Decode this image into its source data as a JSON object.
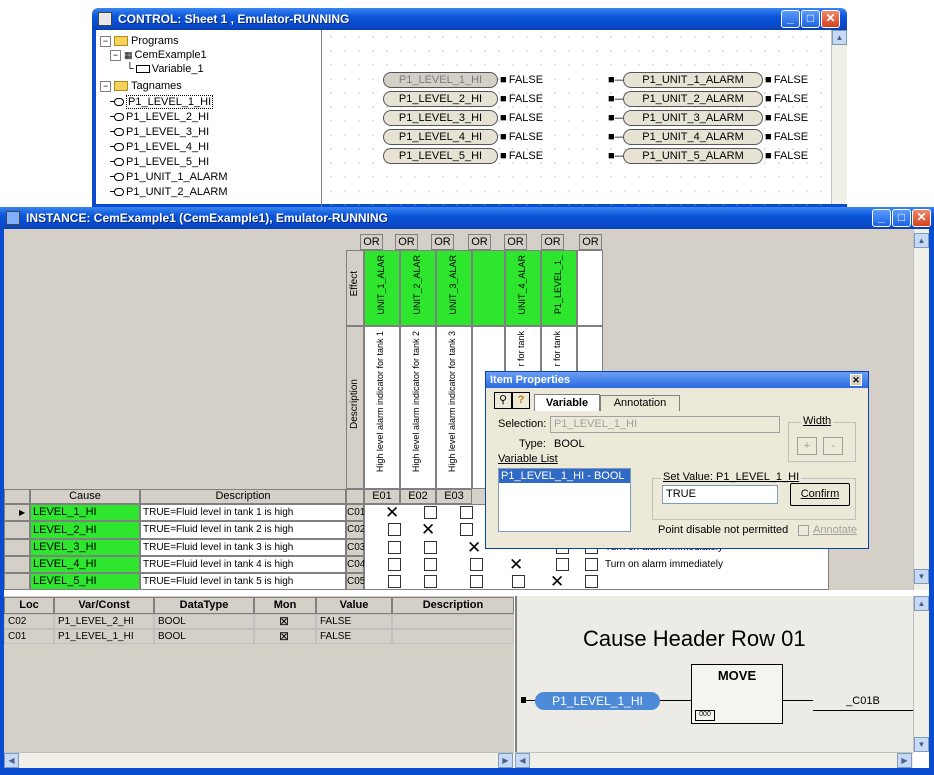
{
  "control_window": {
    "title": "CONTROL: Sheet 1 , Emulator-RUNNING",
    "tree": {
      "programs": "Programs",
      "program_item": "CemExample1",
      "variable_item": "Variable_1",
      "tagnames": "Tagnames",
      "tags": [
        "P1_LEVEL_1_HI",
        "P1_LEVEL_2_HI",
        "P1_LEVEL_3_HI",
        "P1_LEVEL_4_HI",
        "P1_LEVEL_5_HI",
        "P1_UNIT_1_ALARM",
        "P1_UNIT_2_ALARM"
      ]
    },
    "sheet": {
      "inputs": [
        "P1_LEVEL_1_HI",
        "P1_LEVEL_2_HI",
        "P1_LEVEL_3_HI",
        "P1_LEVEL_4_HI",
        "P1_LEVEL_5_HI"
      ],
      "input_values": [
        "FALSE",
        "FALSE",
        "FALSE",
        "FALSE",
        "FALSE"
      ],
      "outputs": [
        "P1_UNIT_1_ALARM",
        "P1_UNIT_2_ALARM",
        "P1_UNIT_3_ALARM",
        "P1_UNIT_4_ALARM",
        "P1_UNIT_5_ALARM"
      ],
      "output_values": [
        "FALSE",
        "FALSE",
        "FALSE",
        "FALSE",
        "FALSE"
      ]
    }
  },
  "instance_window": {
    "title": "INSTANCE: CemExample1  (CemExample1), Emulator-RUNNING",
    "effect_label": "Effect",
    "description_label": "Description",
    "or_labels": [
      "OR",
      "OR",
      "OR",
      "OR",
      "OR",
      "OR"
    ],
    "effects": [
      "UNIT_1_ALAR",
      "UNIT_2_ALAR",
      "UNIT_3_ALAR",
      "UNIT_4_ALAR",
      "P1_LEVEL_1_"
    ],
    "effect_descriptions": [
      "High level alarm indicator for tank 1",
      "High level alarm indicator for tank 2",
      "High level alarm indicator for tank 3",
      "r for tank",
      "r for tank"
    ],
    "effect_ids": [
      "E01",
      "E02",
      "E03"
    ],
    "cause_header": "Cause",
    "description_header": "Description",
    "causes": [
      {
        "name": "LEVEL_1_HI",
        "desc": "TRUE=Fluid level in tank 1 is high",
        "id": "C01"
      },
      {
        "name": "LEVEL_2_HI",
        "desc": "TRUE=Fluid level in tank 2  is high",
        "id": "C02"
      },
      {
        "name": "LEVEL_3_HI",
        "desc": "TRUE=Fluid level in tank 3 is high",
        "id": "C03"
      },
      {
        "name": "LEVEL_4_HI",
        "desc": "TRUE=Fluid level in tank 4 is high",
        "id": "C04"
      },
      {
        "name": "LEVEL_5_HI",
        "desc": "TRUE=Fluid level in tank 5 is high",
        "id": "C05"
      }
    ],
    "row_actions": [
      "Turn on alarm immediately",
      "Turn on alarm immediately"
    ],
    "var_table": {
      "headers": [
        "Loc",
        "Var/Const",
        "DataType",
        "Mon",
        "Value",
        "Description"
      ],
      "rows": [
        {
          "loc": "C02",
          "var": "P1_LEVEL_2_HI",
          "type": "BOOL",
          "value": "FALSE",
          "desc": ""
        },
        {
          "loc": "C01",
          "var": "P1_LEVEL_1_HI",
          "type": "BOOL",
          "value": "FALSE",
          "desc": ""
        }
      ]
    },
    "logic": {
      "title": "Cause Header Row 01",
      "block": "MOVE",
      "block_tag": "000",
      "input": "P1_LEVEL_1_HI",
      "output": "_C01B"
    }
  },
  "item_properties": {
    "title": "Item Properties",
    "tab_variable": "Variable",
    "tab_annotation": "Annotation",
    "selection_label": "Selection:",
    "selection_value": "P1_LEVEL_1_HI",
    "type_label": "Type:",
    "type_value": "BOOL",
    "variable_list_label": "Variable List",
    "variable_list_items": [
      "P1_LEVEL_1_HI - BOOL"
    ],
    "width_label": "Width",
    "plus": "+",
    "minus": "-",
    "set_value_label": "Set Value: P1_LEVEL_1_HI",
    "set_value": "TRUE",
    "confirm": "Confirm",
    "point_disable": "Point disable not permitted",
    "annotate": "Annotate"
  },
  "colors": {
    "title_blue": "#0a55d8",
    "cause_green": "#2ee62e",
    "panel_gray": "#d4d0c8"
  }
}
